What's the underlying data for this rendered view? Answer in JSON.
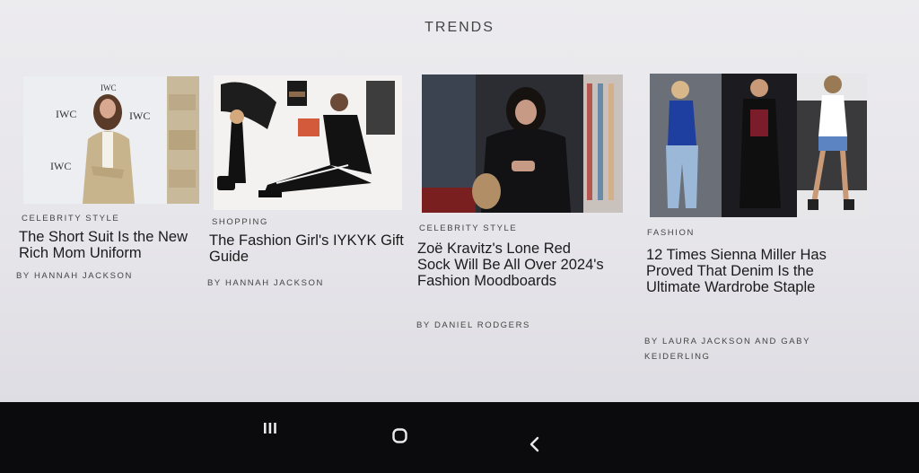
{
  "section": {
    "title": "TRENDS"
  },
  "articles": [
    {
      "kicker": "CELEBRITY STYLE",
      "title": "The Short Suit Is the New Rich Mom Uniform",
      "byline": "BY HANNAH JACKSON",
      "photo_text": [
        "IWC",
        "IWC",
        "IWC",
        "IWC"
      ]
    },
    {
      "kicker": "SHOPPING",
      "title": "The Fashion Girl's IYKYK Gift Guide",
      "byline": "BY HANNAH JACKSON"
    },
    {
      "kicker": "CELEBRITY STYLE",
      "title": "Zoë Kravitz's Lone Red Sock Will Be All Over 2024's Fashion Moodboards",
      "byline": "BY DANIEL RODGERS"
    },
    {
      "kicker": "FASHION",
      "title": "12 Times Sienna Miller Has Proved That Denim Is the Ultimate Wardrobe Staple",
      "byline": "BY LAURA JACKSON AND GABY KEIDERLING"
    }
  ],
  "navbar": {
    "recents_icon": "recents-icon",
    "home_icon": "home-icon",
    "back_icon": "back-icon"
  }
}
